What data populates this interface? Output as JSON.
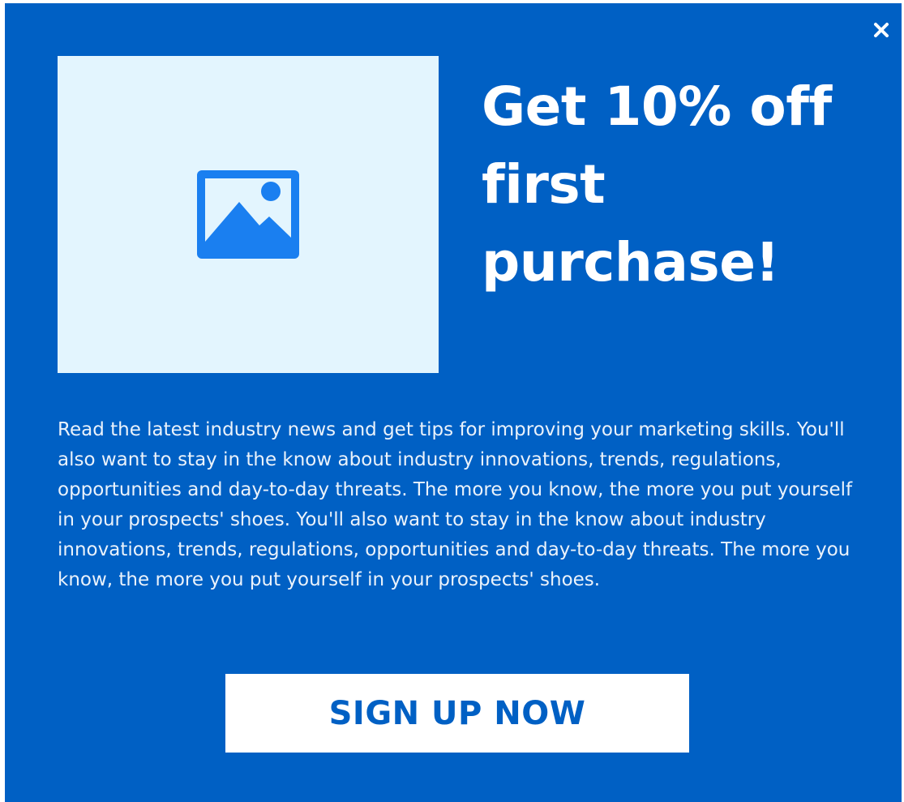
{
  "popup": {
    "headline": "Get 10% off first purchase!",
    "body": "Read the latest industry news and get tips for improving your marketing skills. You'll also want to stay in the know about industry innovations, trends, regulations, opportunities and day-to-day threats. The more you know, the more you put yourself in your prospects' shoes. You'll also want to stay in the know about industry innovations, trends, regulations, opportunities and day-to-day threats. The more you know, the more you put yourself in your prospects' shoes.",
    "cta_label": "SIGN UP NOW",
    "close_icon": "close-icon",
    "image_icon": "image-placeholder-icon"
  },
  "colors": {
    "background": "#0060c4",
    "image_placeholder": "#e3f5fe",
    "image_icon": "#1a7ff0",
    "text": "#ffffff",
    "button_background": "#ffffff",
    "button_text": "#0060c4"
  }
}
